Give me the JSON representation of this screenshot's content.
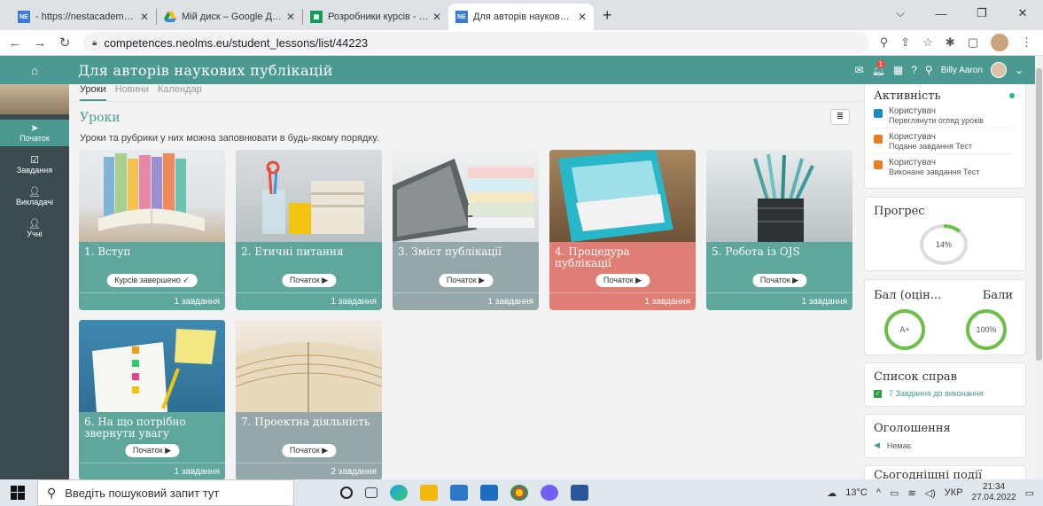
{
  "browser": {
    "tabs": [
      {
        "favicon": "NE",
        "title": "- https://nestacademyonline.neol",
        "active": false
      },
      {
        "favicon": "drive",
        "title": "Мій диск – Google Диск",
        "active": false
      },
      {
        "favicon": "sheets",
        "title": "Розробники курсів - Google Та",
        "active": false
      },
      {
        "favicon": "NE",
        "title": "Для авторів наукових публікаці",
        "active": true
      }
    ],
    "new_tab": "+",
    "url": "competences.neolms.eu/student_lessons/list/44223"
  },
  "header": {
    "home_icon": "home-icon",
    "title": "Для авторів наукових публікацій",
    "notif_count": "1",
    "user_name": "Billy Aaron"
  },
  "sidebar": {
    "items": [
      {
        "label": "Початок",
        "icon": "pin-icon",
        "active": true
      },
      {
        "label": "Завдання",
        "icon": "checkbox-icon",
        "active": false
      },
      {
        "label": "Викладачі",
        "icon": "person-icon",
        "active": false
      },
      {
        "label": "Учні",
        "icon": "person-icon",
        "active": false
      }
    ]
  },
  "main": {
    "subnav": [
      "Уроки",
      "Новини",
      "Календар"
    ],
    "section_title": "Уроки",
    "description": "Уроки та рубрики у них можна заповнювати в будь-якому порядку.",
    "cards": [
      {
        "title": "1. Вступ",
        "button": "Курсів завершено ✓",
        "footer": "1 завдання",
        "color": "#5fa69c"
      },
      {
        "title": "2. Етичні питання",
        "button": "Початок ▶",
        "footer": "1 завдання",
        "color": "#5fa69c"
      },
      {
        "title": "3. Зміст публікації",
        "button": "Початок ▶",
        "footer": "1 завдання",
        "color": "#94a7a9"
      },
      {
        "title": "4. Процедура публікації",
        "button": "Початок ▶",
        "footer": "1 завдання",
        "color": "#e07d74"
      },
      {
        "title": "5. Робота із OJS",
        "button": "Початок ▶",
        "footer": "1 завдання",
        "color": "#5fa69c"
      },
      {
        "title": "6. На що потрібно звернути увагу",
        "button": "Початок ▶",
        "footer": "1 завдання",
        "color": "#5fa69c"
      },
      {
        "title": "7. Проектна діяльність",
        "button": "Початок ▶",
        "footer": "2 завдання",
        "color": "#94a7a9"
      }
    ]
  },
  "right_panel": {
    "activity": {
      "title": "Активність",
      "items": [
        {
          "who": "Користувач",
          "what": "Переглянути огляд уроків"
        },
        {
          "who": "Користувач",
          "what": "Подане завдання Тест"
        },
        {
          "who": "Користувач",
          "what": "Виконане завдання Тест"
        }
      ]
    },
    "progress": {
      "title": "Прогрес",
      "value": "14%",
      "fraction": 0.14
    },
    "grades": {
      "title_left": "Бал (оцін...",
      "title_right": "Бали",
      "grade": "A+",
      "points": "100%"
    },
    "todo": {
      "title": "Список справ",
      "item": "7 Завдання до виконання"
    },
    "announcements": {
      "title": "Оголошення",
      "item": "Немає"
    },
    "events": {
      "title": "Сьогоднішні події"
    }
  },
  "taskbar": {
    "search_placeholder": "Введіть пошуковий запит тут",
    "weather": "13°C",
    "lang": "УКР",
    "time": "21:34",
    "date": "27.04.2022"
  },
  "colors": {
    "accent": "#4a9a91",
    "sidebar": "#3c4b4f",
    "orange": "#e67e22"
  }
}
